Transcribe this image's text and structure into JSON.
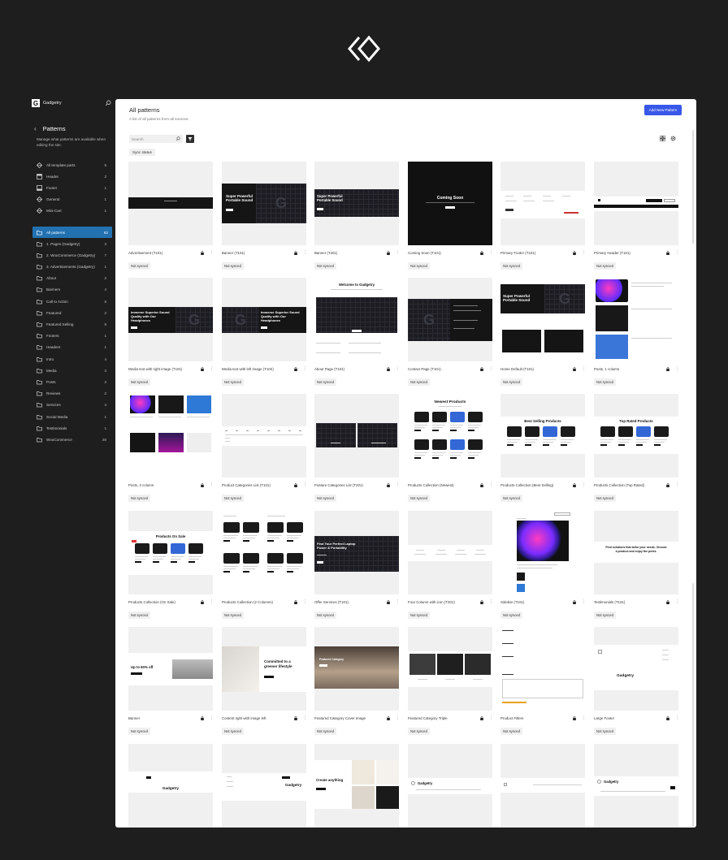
{
  "sidebar": {
    "site_name": "Gadgetry",
    "logo_letter": "G",
    "title": "Patterns",
    "description": "Manage what patterns are available when editing the site.",
    "template_parts": [
      {
        "label": "All template parts",
        "count": "5",
        "icon": "diamond-icon"
      },
      {
        "label": "Header",
        "count": "2",
        "icon": "header-icon"
      },
      {
        "label": "Footer",
        "count": "1",
        "icon": "footer-icon"
      },
      {
        "label": "General",
        "count": "1",
        "icon": "diamond-icon"
      },
      {
        "label": "Mini-Cart",
        "count": "1",
        "icon": "diamond-icon"
      }
    ],
    "categories": [
      {
        "label": "All patterns",
        "count": "62",
        "active": true
      },
      {
        "label": "1. Pages (Gadgetry)",
        "count": "3"
      },
      {
        "label": "2. WooCommerce (Gadgetry)",
        "count": "7"
      },
      {
        "label": "3. Advertisements (Gadgetry)",
        "count": "1"
      },
      {
        "label": "About",
        "count": "2"
      },
      {
        "label": "Banners",
        "count": "4"
      },
      {
        "label": "Call to Action",
        "count": "6"
      },
      {
        "label": "Featured",
        "count": "2"
      },
      {
        "label": "Featured Selling",
        "count": "8"
      },
      {
        "label": "Footers",
        "count": "1"
      },
      {
        "label": "Headers",
        "count": "1"
      },
      {
        "label": "Intro",
        "count": "4"
      },
      {
        "label": "Media",
        "count": "3"
      },
      {
        "label": "Posts",
        "count": "3"
      },
      {
        "label": "Reviews",
        "count": "2"
      },
      {
        "label": "Services",
        "count": "4"
      },
      {
        "label": "Social Media",
        "count": "1"
      },
      {
        "label": "Testimonials",
        "count": "1"
      },
      {
        "label": "WooCommerce",
        "count": "28"
      }
    ]
  },
  "main": {
    "title": "All patterns",
    "subtitle": "A list of all patterns from all sources.",
    "add_button": "Add New Pattern",
    "search_placeholder": "Search",
    "sync_filter": "Sync status",
    "badge": "Not synced",
    "cards": [
      {
        "name": "Advertisement (T101)",
        "lock": true
      },
      {
        "name": "Banner (T101)",
        "lock": true
      },
      {
        "name": "Banner (T201)",
        "lock": true
      },
      {
        "name": "Coming Soon (T101)",
        "lock": true
      },
      {
        "name": "Primary Footer (T101)",
        "lock": true
      },
      {
        "name": "Primary Header (T101)",
        "lock": true
      },
      {
        "name": "Media text with right image (T101)",
        "lock": true
      },
      {
        "name": "Media text with left image (T102)",
        "lock": true
      },
      {
        "name": "About Page (T101)",
        "lock": true
      },
      {
        "name": "Contact Page (T101)",
        "lock": true
      },
      {
        "name": "Home Default (T101)",
        "lock": true
      },
      {
        "name": "Posts, 1 column",
        "lock": true
      },
      {
        "name": "Posts, 3 column",
        "lock": true
      },
      {
        "name": "Product Categories List (T101)",
        "lock": true
      },
      {
        "name": "Feature Categories List (T201)",
        "lock": true
      },
      {
        "name": "Products Collection (Newest)",
        "lock": true
      },
      {
        "name": "Products Collection (Best Selling)",
        "lock": true
      },
      {
        "name": "Products Collection (Top Rated)",
        "lock": true
      },
      {
        "name": "Products Collection (On Sale)",
        "lock": true
      },
      {
        "name": "Products Collection (2 Columns)",
        "lock": true
      },
      {
        "name": "Offer Services (T101)",
        "lock": true
      },
      {
        "name": "Four Column with icon (T201)",
        "lock": true
      },
      {
        "name": "Sidebar (T101)",
        "lock": true
      },
      {
        "name": "Testimonials (T101)",
        "lock": true
      },
      {
        "name": "Banner",
        "lock": true
      },
      {
        "name": "Content right with image left",
        "lock": true
      },
      {
        "name": "Featured Category Cover Image",
        "lock": true
      },
      {
        "name": "Featured Category Triple",
        "lock": true
      },
      {
        "name": "Product Filters",
        "lock": true
      },
      {
        "name": "Large Footer",
        "lock": true
      },
      {
        "name": "",
        "lock": false
      },
      {
        "name": "",
        "lock": false
      },
      {
        "name": "",
        "lock": false
      },
      {
        "name": "",
        "lock": false
      },
      {
        "name": "",
        "lock": false
      },
      {
        "name": "",
        "lock": false
      }
    ],
    "thumb_text": {
      "super_powerful": "Super Powerful Portable Sound",
      "coming_soon": "Coming Soon",
      "immerse": "Immerse Superior Sound Quality with Our Headphones",
      "welcome": "Welcome to Gadgetry",
      "newest": "Newest Products",
      "best_selling": "Best Selling Products",
      "top_rated": "Top Rated Products",
      "on_sale": "Products On Sale",
      "offer": "Find Your Perfect Laptop Power & Portability",
      "upto": "Up to 60% off",
      "committed": "Committed to a greener lifestyle",
      "create": "Create anything",
      "gadgetry": "Gadgetry"
    }
  }
}
